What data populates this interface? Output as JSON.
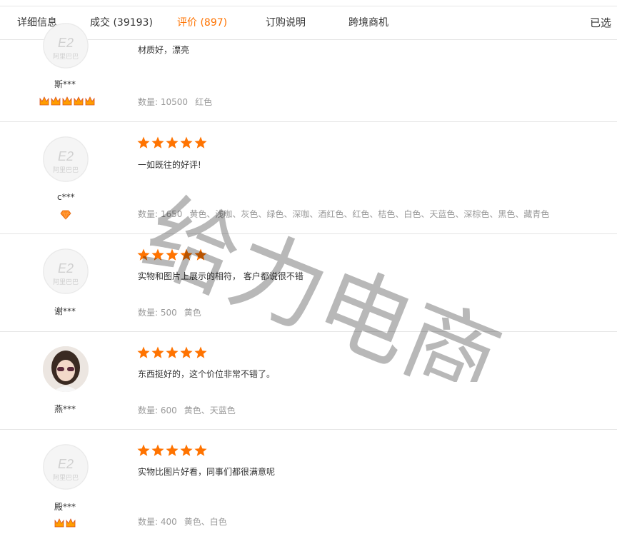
{
  "tabs": [
    {
      "label": "详细信息",
      "active": false
    },
    {
      "label": "成交 (39193)",
      "active": false
    },
    {
      "label": "评价 (897)",
      "active": true
    },
    {
      "label": "订购说明",
      "active": false
    },
    {
      "label": "跨境商机",
      "active": false
    }
  ],
  "selected_label": "已选",
  "colors": {
    "accent": "#ff7300",
    "muted": "#999999",
    "border": "#e5e5e5"
  },
  "quantity_label": "数量:",
  "reviews": [
    {
      "user": "斯***",
      "badge": "crown-icons",
      "rating": null,
      "content": "材质好，漂亮",
      "quantity": "10500",
      "colors": "红色",
      "avatar": "alibaba-default"
    },
    {
      "user": "c***",
      "badge": "diamond-icon",
      "rating": 5,
      "content": "一如既往的好评!",
      "quantity": "1650",
      "colors": "黄色、浅咖、灰色、绿色、深咖、酒红色、红色、桔色、白色、天蓝色、深棕色、黑色、藏青色",
      "avatar": "alibaba-default"
    },
    {
      "user": "谢***",
      "badge": null,
      "rating": 5,
      "content": "实物和图片上展示的相符， 客户都说很不错",
      "quantity": "500",
      "colors": "黄色",
      "avatar": "alibaba-default"
    },
    {
      "user": "燕***",
      "badge": null,
      "rating": 5,
      "content": "东西挺好的，这个价位非常不错了。",
      "quantity": "600",
      "colors": "黄色、天蓝色",
      "avatar": "user-photo"
    },
    {
      "user": "殿***",
      "badge": "crown-icons",
      "rating": 5,
      "content": "实物比图片好看，同事们都很满意呢",
      "quantity": "400",
      "colors": "黄色、白色",
      "avatar": "alibaba-default"
    }
  ],
  "watermark": "给力电商"
}
